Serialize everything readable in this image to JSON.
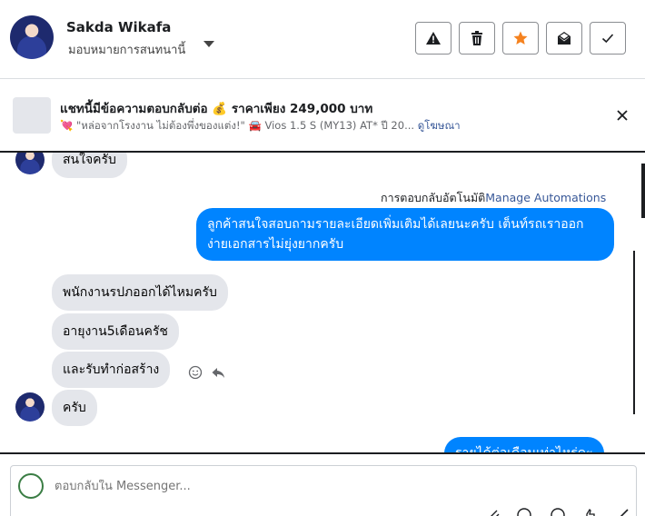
{
  "header": {
    "contact_name": "Sakda Wikafa",
    "assign_label": "มอบหมายการสนทนานี้",
    "actions": [
      {
        "name": "spam",
        "icon": "warning-icon"
      },
      {
        "name": "delete",
        "icon": "trash-icon"
      },
      {
        "name": "star",
        "icon": "star-icon",
        "color": "#f5821f"
      },
      {
        "name": "mark-unread",
        "icon": "envelope-open-icon"
      },
      {
        "name": "done",
        "icon": "check-icon"
      }
    ]
  },
  "ad": {
    "title": "แชทนี้มีข้อความตอบกลับต่อ 💰 ราคาเพียง 249,000 บาท",
    "subtitle": "💘 \"หล่อจากโรงงาน ไม่ต้องพึ่งของแต่ง!\" 🚘 Vios 1.5 S (MY13) AT* ปี 20...",
    "link": "ดูโฆษณา"
  },
  "chat": {
    "top_partial_message": "สนใจครับ",
    "automation_label": "การตอบกลับอัตโนมัติ",
    "automation_link": "Manage Automations",
    "outgoing_1": "ลูกค้าสนใจสอบถามรายละเอียดเพิ่มเติมได้เลยนะครับ เต็นท์รถเราออกง่ายเอกสารไม่ยุ่งยากครับ",
    "incoming": [
      "พนักงานรปภออกได้ไหมครับ",
      "อายุงาน5เดือนครัช",
      "และรับทำก่อสร้าง",
      "ครับ"
    ],
    "outgoing_partial": "รายได้ต่อเดือนเท่าไหร่คะ"
  },
  "composer": {
    "placeholder": "ตอบกลับใน Messenger..."
  },
  "colors": {
    "outgoing_bubble": "#0084ff",
    "incoming_bubble": "#e4e6eb",
    "star": "#f5821f"
  }
}
